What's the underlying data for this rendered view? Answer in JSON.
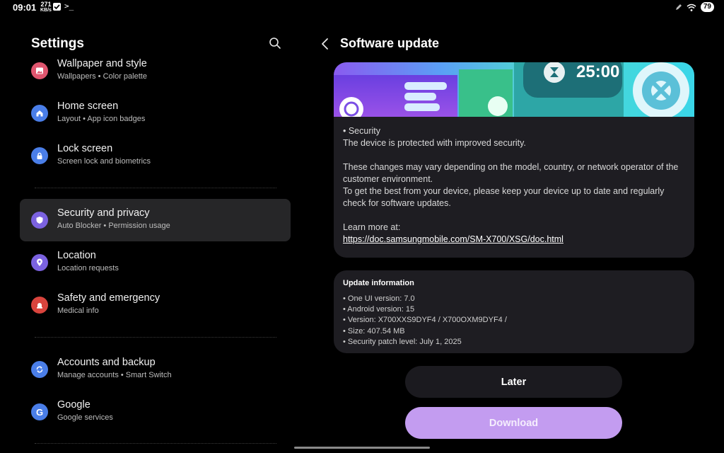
{
  "status_bar": {
    "time": "09:01",
    "net_speed_value": "271",
    "net_speed_unit": "KB/s",
    "battery": "79"
  },
  "settings": {
    "title": "Settings",
    "items": [
      {
        "title": "Wallpaper and style",
        "subtitle": "Wallpapers  •  Color palette",
        "icon": "image-icon",
        "color": "#e0566f"
      },
      {
        "title": "Home screen",
        "subtitle": "Layout  •  App icon badges",
        "icon": "home-icon",
        "color": "#4a7ee8"
      },
      {
        "title": "Lock screen",
        "subtitle": "Screen lock and biometrics",
        "icon": "lock-icon",
        "color": "#4a7ee8"
      },
      {
        "title": "Security and privacy",
        "subtitle": "Auto Blocker  •  Permission usage",
        "icon": "shield-icon",
        "color": "#7b62e0"
      },
      {
        "title": "Location",
        "subtitle": "Location requests",
        "icon": "location-pin-icon",
        "color": "#7b62e0"
      },
      {
        "title": "Safety and emergency",
        "subtitle": "Medical info",
        "icon": "siren-icon",
        "color": "#d9443d"
      },
      {
        "title": "Accounts and backup",
        "subtitle": "Manage accounts  •  Smart Switch",
        "icon": "sync-icon",
        "color": "#4a7ee8"
      },
      {
        "title": "Google",
        "subtitle": "Google services",
        "icon": "google-icon",
        "color": "#4a7ee8"
      }
    ]
  },
  "software_update": {
    "title": "Software update",
    "banner_text": "25:00",
    "security_heading": "• Security",
    "security_text": "The device is protected with improved security.",
    "disclaimer_1": "These changes may vary depending on the model, country, or network operator of the customer environment.",
    "disclaimer_2": "To get the best from your device, please keep your device up to date and regularly check for software updates.",
    "learn_more": "Learn more at:",
    "link": "https://doc.samsungmobile.com/SM-X700/XSG/doc.html",
    "update_info_title": "Update information",
    "update_info": [
      "• One UI version: 7.0",
      "• Android version: 15",
      "• Version: X700XXS9DYF4 / X700OXM9DYF4 /",
      "• Size: 407.54 MB",
      "• Security patch level: July 1, 2025"
    ],
    "later_label": "Later",
    "download_label": "Download"
  }
}
